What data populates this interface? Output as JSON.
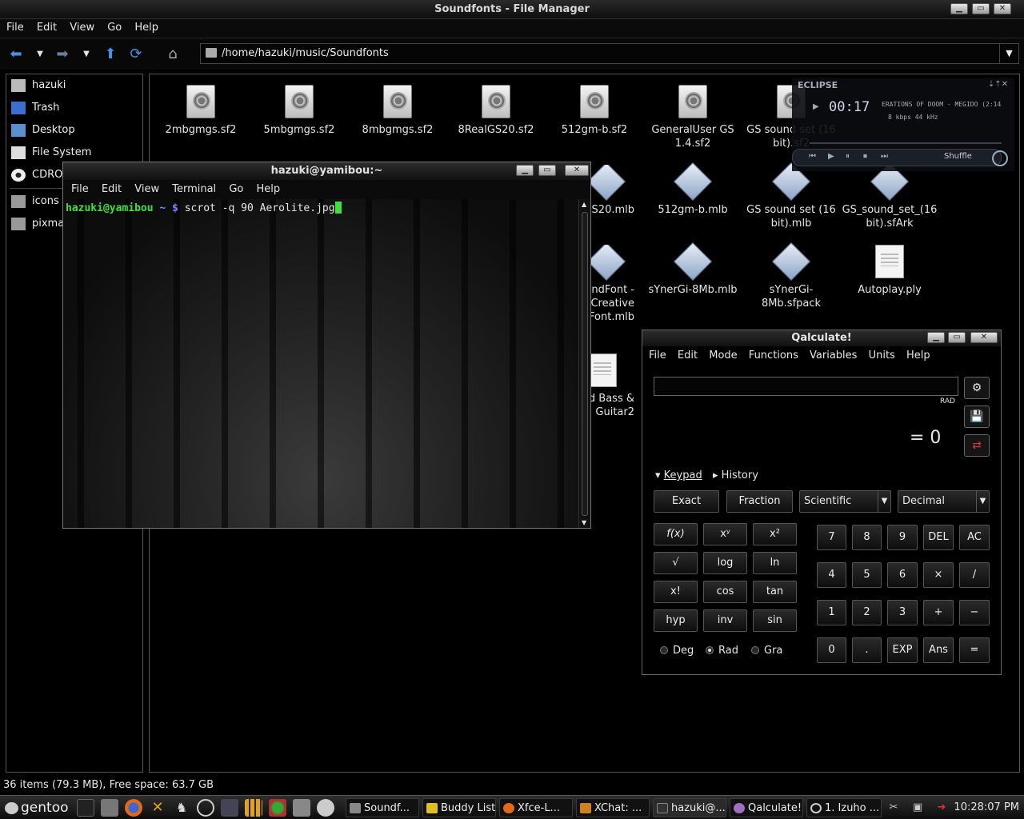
{
  "filemanager": {
    "title": "Soundfonts - File Manager",
    "menu": [
      "File",
      "Edit",
      "View",
      "Go",
      "Help"
    ],
    "address": "/home/hazuki/music/Soundfonts",
    "sidebar": [
      "hazuki",
      "Trash",
      "Desktop",
      "File System",
      "CDROM",
      "icons",
      "pixmaps"
    ],
    "status": "36 items (79.3 MB), Free space: 63.7 GB",
    "files": [
      {
        "name": "2mbgmgs.sf2",
        "type": "doc"
      },
      {
        "name": "5mbgmgs.sf2",
        "type": "doc"
      },
      {
        "name": "8mbgmgs.sf2",
        "type": "doc"
      },
      {
        "name": "8RealGS20.sf2",
        "type": "doc"
      },
      {
        "name": "512gm-b.sf2",
        "type": "doc"
      },
      {
        "name": "GeneralUser GS 1.4.sf2",
        "type": "doc"
      },
      {
        "name": "GS sound set (16 bit).sf2",
        "type": "doc"
      },
      {
        "name": "8RealGS20.mlb",
        "type": "diamond"
      },
      {
        "name": "512gm-b.mlb",
        "type": "diamond"
      },
      {
        "name": "GS sound set (16 bit).mlb",
        "type": "diamond"
      },
      {
        "name": "GS_sound_set_(16 bit).sfArk",
        "type": "diamond"
      },
      {
        "name": "SoundFont - Creative SoundFont.mlb",
        "type": "diamond"
      },
      {
        "name": "sYnerGi-8Mb.mlb",
        "type": "diamond"
      },
      {
        "name": "sYnerGi-8Mb.sfpack",
        "type": "diamond"
      },
      {
        "name": "Autoplay.ply",
        "type": "plain"
      },
      {
        "name": "Fingered Bass & Guitar2",
        "type": "plain"
      }
    ]
  },
  "terminal": {
    "title": "hazuki@yamibou:~",
    "menu": [
      "File",
      "Edit",
      "View",
      "Terminal",
      "Go",
      "Help"
    ],
    "prompt_user": "hazuki@yamibou",
    "prompt_dir": "~ $",
    "command": "scrot -q 90 Aerolite.jpg"
  },
  "player": {
    "brand": "ECLIPSE",
    "time": "00:17",
    "song": "ERATIONS OF DOOM - MEGIDO (2:14",
    "rate": "8 kbps 44 kHz",
    "shuffle": "Shuffle"
  },
  "qalculate": {
    "title": "Qalculate!",
    "menu": [
      "File",
      "Edit",
      "Mode",
      "Functions",
      "Variables",
      "Units",
      "Help"
    ],
    "angle_indicator": "RAD",
    "result": "= 0",
    "keypad_label": "Keypad",
    "history_label": "History",
    "mode_buttons": [
      "Exact",
      "Fraction"
    ],
    "selects": [
      "Scientific",
      "Decimal"
    ],
    "function_keys": [
      [
        "f(x)",
        "xʸ",
        "x²"
      ],
      [
        "√",
        "log",
        "ln"
      ],
      [
        "x!",
        "cos",
        "tan"
      ],
      [
        "hyp",
        "inv",
        "sin"
      ]
    ],
    "number_keys": [
      [
        "7",
        "8",
        "9",
        "DEL",
        "AC"
      ],
      [
        "4",
        "5",
        "6",
        "×",
        "/"
      ],
      [
        "1",
        "2",
        "3",
        "+",
        "−"
      ],
      [
        "0",
        ".",
        "EXP",
        "Ans",
        "="
      ]
    ],
    "angle_modes": [
      "Deg",
      "Rad",
      "Gra"
    ],
    "angle_selected": "Rad"
  },
  "taskbar": {
    "start": "gentoo",
    "tasks": [
      "Soundf...",
      "Buddy List",
      "Xfce-L...",
      "XChat: ...",
      "hazuki@...",
      "Qalculate!",
      "1. Izuho ..."
    ],
    "clock": "10:28:07 PM"
  }
}
